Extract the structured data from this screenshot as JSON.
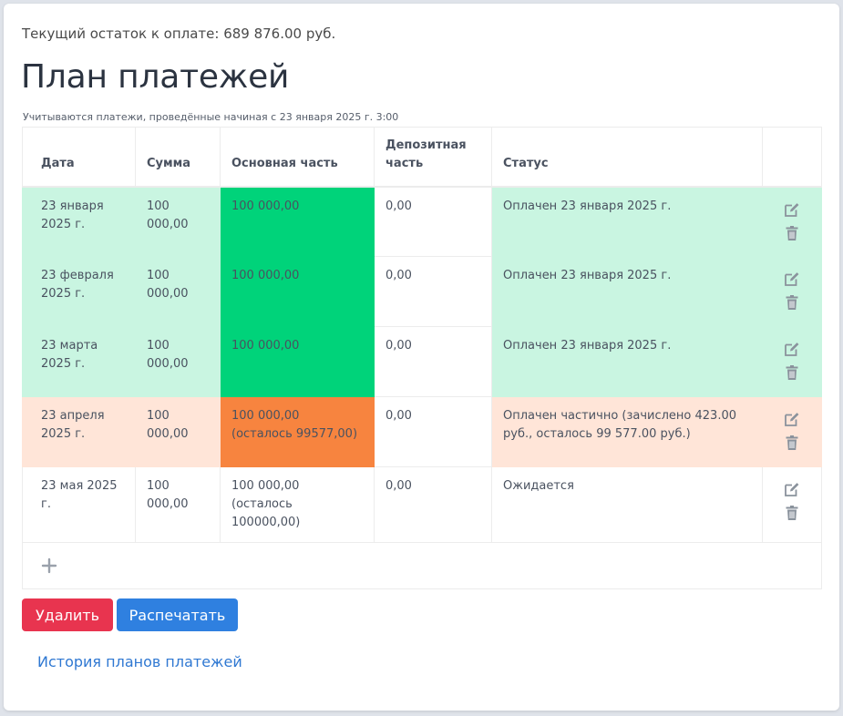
{
  "balance_text": "Текущий остаток к оплате: 689 876.00 руб.",
  "title": "План платежей",
  "subtitle": "Учитываются платежи, проведённые начиная с 23 января 2025 г. 3:00",
  "table": {
    "headers": [
      "Дата",
      "Сумма",
      "Основная часть",
      "Депозитная часть",
      "Статус",
      ""
    ],
    "rows": [
      {
        "date": "23 января 2025 г.",
        "amount": "100 000,00",
        "main": "100 000,00",
        "deposit": "0,00",
        "status": "Оплачен 23 января 2025 г.",
        "state": "paid"
      },
      {
        "date": "23 февраля 2025 г.",
        "amount": "100 000,00",
        "main": "100 000,00",
        "deposit": "0,00",
        "status": "Оплачен 23 января 2025 г.",
        "state": "paid"
      },
      {
        "date": "23 марта 2025 г.",
        "amount": "100 000,00",
        "main": "100 000,00",
        "deposit": "0,00",
        "status": "Оплачен 23 января 2025 г.",
        "state": "paid"
      },
      {
        "date": "23 апреля 2025 г.",
        "amount": "100 000,00",
        "main": "100 000,00 (осталось 99577,00)",
        "deposit": "0,00",
        "status": "Оплачен частично (зачислено 423.00 руб., осталось 99 577.00 руб.)",
        "state": "partial"
      },
      {
        "date": "23 мая 2025 г.",
        "amount": "100 000,00",
        "main": "100 000,00 (осталось 100000,00)",
        "deposit": "0,00",
        "status": "Ожидается",
        "state": "pending"
      }
    ],
    "row_action_icons": [
      "edit-icon",
      "trash-icon"
    ],
    "add_icon": "plus-icon"
  },
  "buttons": {
    "delete_label": "Удалить",
    "print_label": "Распечатать"
  },
  "history_link": "История планов платежей",
  "colors": {
    "paid_row": "#c9f5e1",
    "paid_main": "#00d37a",
    "partial_row": "#ffe5d8",
    "partial_main": "#f7843f",
    "delete_button": "#e8344f",
    "print_button": "#2f80e0",
    "link": "#2f78d2"
  }
}
